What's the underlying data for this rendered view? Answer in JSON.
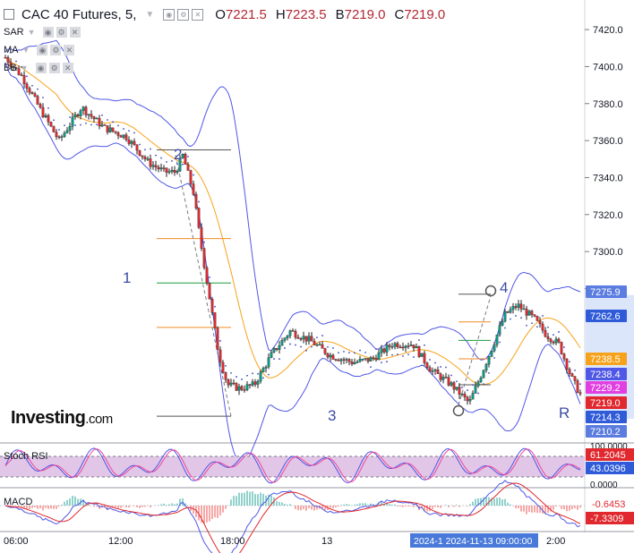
{
  "header": {
    "symbol": "CAC 40 Futures, 5,",
    "open_label": "O",
    "open": "7221.5",
    "high_label": "H",
    "high": "7223.5",
    "low_label": "B",
    "low": "7219.0",
    "close_label": "C",
    "close": "7219.0"
  },
  "indicators": [
    "SAR",
    "MA",
    "BB"
  ],
  "logo": {
    "brand": "Investing",
    "suffix": ".com"
  },
  "colors": {
    "up": "#089981",
    "down": "#e0282e",
    "bb": "#4f57e6",
    "ma": "#f7a21b",
    "sar": "#3d49c7",
    "stoch_k": "#4f57e6",
    "stoch_d": "#f0489c",
    "macd": "#4f57e6",
    "signal": "#e0282e"
  },
  "chart_data": [
    {
      "type": "candlestick",
      "title": "CAC 40 Futures, 5,",
      "ylim": [
        7198,
        7436
      ],
      "y_ticks": [
        7280,
        7300,
        7320,
        7340,
        7360,
        7380,
        7400,
        7420
      ],
      "x_ticks": [
        "06:00",
        "12:00",
        "18:00",
        "13",
        "2:00"
      ],
      "price_path": [
        {
          "t": 0,
          "p": 7405
        },
        {
          "t": 18,
          "p": 7395
        },
        {
          "t": 40,
          "p": 7376
        },
        {
          "t": 60,
          "p": 7360
        },
        {
          "t": 85,
          "p": 7378
        },
        {
          "t": 110,
          "p": 7367
        },
        {
          "t": 135,
          "p": 7362
        },
        {
          "t": 160,
          "p": 7348
        },
        {
          "t": 178,
          "p": 7343
        },
        {
          "t": 190,
          "p": 7343
        },
        {
          "t": 198,
          "p": 7352
        },
        {
          "t": 210,
          "p": 7332
        },
        {
          "t": 218,
          "p": 7305
        },
        {
          "t": 228,
          "p": 7275
        },
        {
          "t": 238,
          "p": 7245
        },
        {
          "t": 248,
          "p": 7228
        },
        {
          "t": 262,
          "p": 7226
        },
        {
          "t": 278,
          "p": 7228
        },
        {
          "t": 298,
          "p": 7245
        },
        {
          "t": 318,
          "p": 7257
        },
        {
          "t": 340,
          "p": 7252
        },
        {
          "t": 362,
          "p": 7244
        },
        {
          "t": 388,
          "p": 7240
        },
        {
          "t": 410,
          "p": 7242
        },
        {
          "t": 432,
          "p": 7250
        },
        {
          "t": 455,
          "p": 7250
        },
        {
          "t": 475,
          "p": 7236
        },
        {
          "t": 498,
          "p": 7228
        },
        {
          "t": 518,
          "p": 7218
        },
        {
          "t": 530,
          "p": 7232
        },
        {
          "t": 545,
          "p": 7250
        },
        {
          "t": 558,
          "p": 7266
        },
        {
          "t": 572,
          "p": 7271
        },
        {
          "t": 590,
          "p": 7264
        },
        {
          "t": 604,
          "p": 7255
        },
        {
          "t": 618,
          "p": 7250
        },
        {
          "t": 632,
          "p": 7232
        },
        {
          "t": 646,
          "p": 7219
        }
      ],
      "price_labels": [
        {
          "text": "7275.9",
          "bg": "#5b7de0",
          "fg": "#ffffff"
        },
        {
          "text": "7262.6",
          "bg": "#2f5bd9",
          "fg": "#ffffff"
        },
        {
          "text": "7238.5",
          "bg": "#f7a21b",
          "fg": "#ffffff"
        },
        {
          "text": "7238.4",
          "bg": "#4f57e6",
          "fg": "#ffffff"
        },
        {
          "text": "7229.2",
          "bg": "#e040e0",
          "fg": "#ffffff"
        },
        {
          "text": "7219.0",
          "bg": "#e0282e",
          "fg": "#ffffff"
        },
        {
          "text": "7214.3",
          "bg": "#2f5bd9",
          "fg": "#ffffff"
        },
        {
          "text": "7210.2",
          "bg": "#5b7de0",
          "fg": "#ffffff"
        }
      ],
      "wave_labels": [
        "1",
        "2",
        "3",
        "4",
        "R"
      ]
    },
    {
      "type": "line",
      "title": "Stoch RSI",
      "y_ticks": [
        "100.0000",
        "0.0000"
      ],
      "series": [
        {
          "name": "",
          "last": "61.2045",
          "color": "#e0282e"
        },
        {
          "name": "",
          "last": "43.0396",
          "color": "#2f5bd9"
        }
      ]
    },
    {
      "type": "line",
      "title": "MACD",
      "series": [
        {
          "name": "",
          "last": "-0.6453",
          "color": "#e0282e"
        },
        {
          "name": "",
          "last": "-7.3309",
          "color": "#e0282e"
        }
      ]
    }
  ],
  "crosshair_date": "2024-1 2024-11-13 09:00:00"
}
